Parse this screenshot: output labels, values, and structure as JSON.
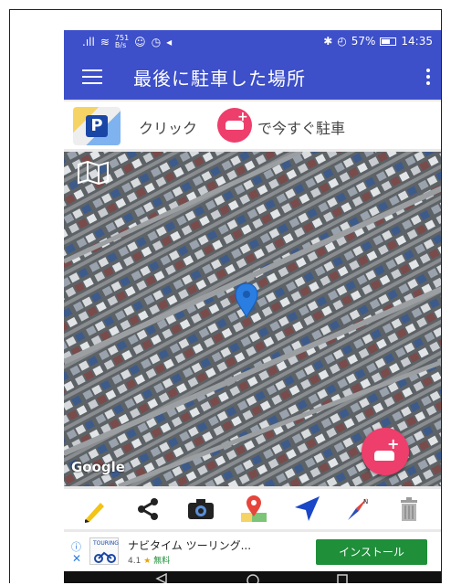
{
  "status_bar": {
    "network_speed_value": "751",
    "network_speed_unit": "B/s",
    "battery": "57%",
    "time": "14:35"
  },
  "app_bar": {
    "title": "最後に駐車した場所"
  },
  "park_bar": {
    "logo_letter": "P",
    "text_before": "クリック",
    "text_after": "で今すぐ駐車"
  },
  "map": {
    "attribution": "Google",
    "marker_color": "#2a7de1"
  },
  "toolbar": {
    "icons": [
      "pencil-icon",
      "share-icon",
      "camera-icon",
      "map-pin-icon",
      "navigation-arrow-icon",
      "compass-icon",
      "trash-icon"
    ]
  },
  "ad": {
    "info_glyph": "ⓘ",
    "close_glyph": "✕",
    "icon_text": "TOURING",
    "title": "ナビタイム ツーリング...",
    "rating": "4.1",
    "star": "★",
    "price": "無料",
    "install_label": "インストール"
  },
  "colors": {
    "app_bar": "#3d4fc9",
    "accent_pink": "#ee3e6b",
    "install_green": "#1f8f3a"
  }
}
